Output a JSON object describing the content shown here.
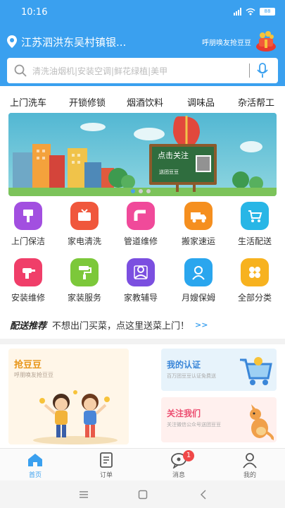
{
  "status": {
    "time": "10:16",
    "battery": "88"
  },
  "header": {
    "location": "江苏泗洪东吴村镇银...",
    "promo": "呼朋唤友抢豆豆"
  },
  "search": {
    "placeholder": "清洗油烟机|安装空调|鲜花绿植|美甲"
  },
  "tabs": [
    "上门洗车",
    "开锁修锁",
    "烟酒饮料",
    "调味品",
    "杂活帮工"
  ],
  "banner": {
    "sign_line1": "点击关注",
    "sign_line2": "送团豆豆"
  },
  "services": [
    {
      "label": "上门保洁",
      "icon": "cleaning-icon",
      "color": "#a24fe0"
    },
    {
      "label": "家电清洗",
      "icon": "tv-icon",
      "color": "#f0573c"
    },
    {
      "label": "管道维修",
      "icon": "pipe-icon",
      "color": "#f04a9a"
    },
    {
      "label": "搬家速运",
      "icon": "truck-icon",
      "color": "#f58f1f"
    },
    {
      "label": "生活配送",
      "icon": "cart-icon",
      "color": "#28b6e6"
    },
    {
      "label": "安装维修",
      "icon": "drill-icon",
      "color": "#f03e69"
    },
    {
      "label": "家装服务",
      "icon": "paint-roller-icon",
      "color": "#7cc83a"
    },
    {
      "label": "家教辅导",
      "icon": "tutor-icon",
      "color": "#7b4fe0"
    },
    {
      "label": "月嫂保姆",
      "icon": "nanny-icon",
      "color": "#2aa6ee"
    },
    {
      "label": "全部分类",
      "icon": "grid-icon",
      "color": "#f7b21f"
    }
  ],
  "recommend": {
    "title": "配送推荐",
    "desc": "不想出门买菜，点这里送菜上门！",
    "more": ">>"
  },
  "cards": {
    "left": {
      "title": "抢豆豆",
      "subtitle": "呼朋唤友抢豆豆"
    },
    "right_top": {
      "title": "我的认证",
      "subtitle": "百万团豆豆认证免费送"
    },
    "right_bottom": {
      "title": "关注我们",
      "subtitle": "关注微信公众号送团豆豆"
    }
  },
  "nav": {
    "items": [
      {
        "label": "首页",
        "icon": "home-icon"
      },
      {
        "label": "订单",
        "icon": "order-icon"
      },
      {
        "label": "消息",
        "icon": "message-icon",
        "badge": "1"
      },
      {
        "label": "我的",
        "icon": "profile-icon"
      }
    ]
  },
  "colors": {
    "brand_blue": "#3aa0ef",
    "accent_orange": "#e8961a"
  }
}
